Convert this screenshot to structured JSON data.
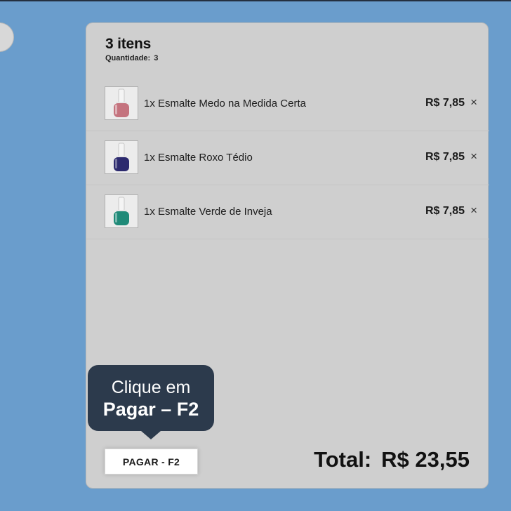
{
  "cart": {
    "count_title": "3 itens",
    "quantity_label": "Quantidade:",
    "quantity_value": "3",
    "items": [
      {
        "name": "1x Esmalte Medo na Medida Certa",
        "price": "R$ 7,85",
        "remove_symbol": "×",
        "polish_color": "#c4737e",
        "icon": "nail-polish-icon"
      },
      {
        "name": "1x Esmalte Roxo Tédio",
        "price": "R$ 7,85",
        "remove_symbol": "×",
        "polish_color": "#2c2a6e",
        "icon": "nail-polish-icon"
      },
      {
        "name": "1x Esmalte Verde de Inveja",
        "price": "R$ 7,85",
        "remove_symbol": "×",
        "polish_color": "#1f8a78",
        "icon": "nail-polish-icon"
      }
    ],
    "pay_button_label": "PAGAR - F2",
    "tooltip": {
      "line1": "Clique em",
      "line2": "Pagar – F2"
    },
    "total_label": "Total:",
    "total_value": "R$ 23,55"
  },
  "colors": {
    "background": "#6a9dcc",
    "panel": "#cfcfcf",
    "tooltip": "#2c3a4c"
  }
}
